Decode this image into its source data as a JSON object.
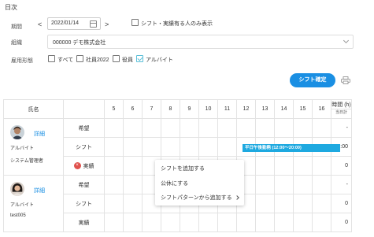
{
  "header": {
    "title": "日次"
  },
  "period": {
    "label": "期間",
    "date_value": "2022/01/14",
    "prev": "<",
    "next": ">",
    "filter_label": "シフト・実績有る人のみ表示"
  },
  "organization": {
    "label": "組織",
    "value": "000000 デモ株式会社"
  },
  "employment": {
    "label": "雇用形態",
    "options": [
      {
        "label": "すべて",
        "checked": false
      },
      {
        "label": "社員2022",
        "checked": false
      },
      {
        "label": "役員",
        "checked": false
      },
      {
        "label": "アルバイト",
        "checked": true
      }
    ]
  },
  "actions": {
    "confirm_label": "シフト確定",
    "print_icon": "printer-icon"
  },
  "grid": {
    "name_header": "氏名",
    "hours": [
      "5",
      "6",
      "7",
      "8",
      "9",
      "10",
      "11",
      "12",
      "13",
      "14",
      "15",
      "16"
    ],
    "hours_header": "時間 (h)",
    "hours_subheader": "当日計",
    "employees": [
      {
        "detail_label": "詳細",
        "role": "アルバイト",
        "name": "システム管理者",
        "rows": [
          {
            "type": "希望",
            "total": "-"
          },
          {
            "type": "シフト",
            "total": "8:00"
          },
          {
            "type": "実績",
            "total": "0",
            "error": true
          }
        ]
      },
      {
        "detail_label": "詳細",
        "role": "アルバイト",
        "name": "test005",
        "rows": [
          {
            "type": "希望",
            "total": "-"
          },
          {
            "type": "シフト",
            "total": "0"
          },
          {
            "type": "実績",
            "total": "0",
            "error": false
          }
        ]
      }
    ],
    "shift_bar_label": "平日午後勤務 (12:00〜20:00)"
  },
  "context_menu": {
    "items": [
      "シフトを追加する",
      "公休にする",
      "シフトパターンから追加する"
    ]
  },
  "colors": {
    "accent": "#1a8fe3",
    "shift_bar": "#1ea9e0",
    "error": "#e0524d",
    "checkbox_checked": "#5bbfd8"
  }
}
